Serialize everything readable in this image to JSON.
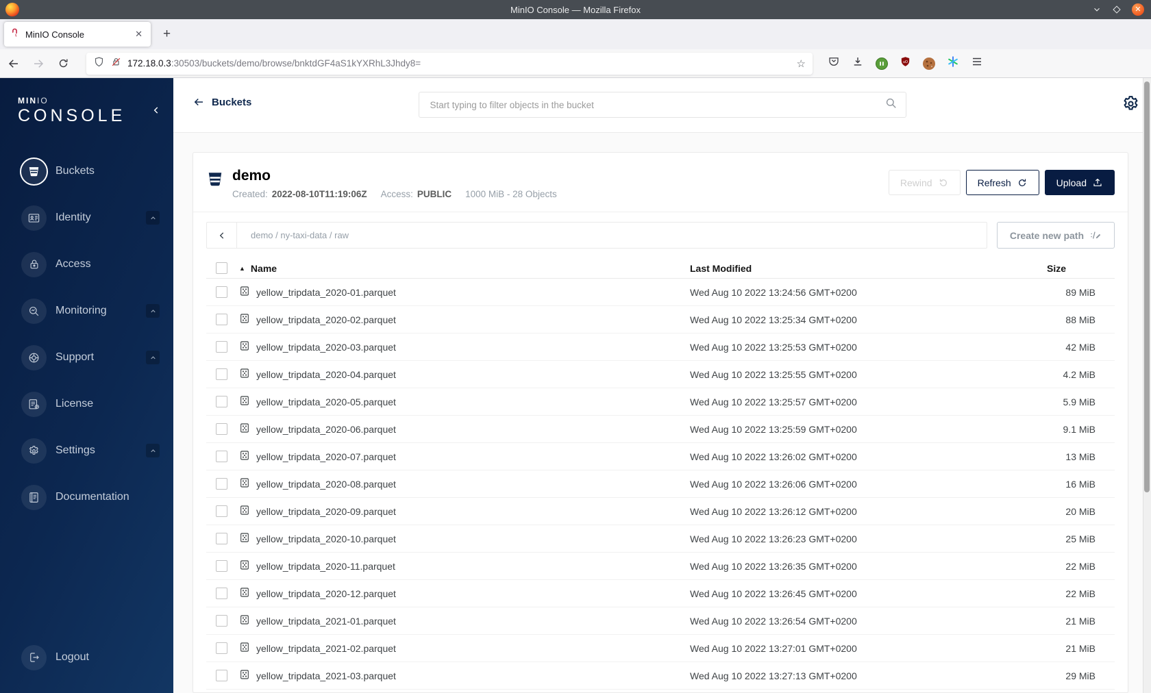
{
  "window": {
    "title": "MinIO Console — Mozilla Firefox"
  },
  "browser": {
    "tab_title": "MinIO Console",
    "tab_close": "✕",
    "new_tab": "+",
    "url_host": "172.18.0.3",
    "url_path": ":30503/buckets/demo/browse/bnktdGF4aS1kYXRhL3Jhdy8=",
    "bookmark_star": "☆"
  },
  "sidebar": {
    "brand_bold": "MIN",
    "brand_light": "IO",
    "product": "CONSOLE",
    "items": [
      {
        "id": "buckets",
        "label": "Buckets",
        "active": true,
        "expandable": false
      },
      {
        "id": "identity",
        "label": "Identity",
        "active": false,
        "expandable": true
      },
      {
        "id": "access",
        "label": "Access",
        "active": false,
        "expandable": false
      },
      {
        "id": "monitoring",
        "label": "Monitoring",
        "active": false,
        "expandable": true
      },
      {
        "id": "support",
        "label": "Support",
        "active": false,
        "expandable": true
      },
      {
        "id": "license",
        "label": "License",
        "active": false,
        "expandable": false
      },
      {
        "id": "settings",
        "label": "Settings",
        "active": false,
        "expandable": true
      },
      {
        "id": "documentation",
        "label": "Documentation",
        "active": false,
        "expandable": false
      }
    ],
    "logout_label": "Logout"
  },
  "topbar": {
    "back_label": "Buckets",
    "search_placeholder": "Start typing to filter objects in the bucket"
  },
  "bucket": {
    "name": "demo",
    "created_label": "Created:",
    "created": "2022-08-10T11:19:06Z",
    "access_label": "Access:",
    "access": "PUBLIC",
    "usage": "1000 MiB - 28 Objects",
    "actions": {
      "rewind": "Rewind",
      "refresh": "Refresh",
      "upload": "Upload"
    }
  },
  "pathbar": {
    "breadcrumb": "demo / ny-taxi-data / raw",
    "create_path": "Create new path"
  },
  "table": {
    "header": {
      "name": "Name",
      "modified": "Last Modified",
      "size": "Size",
      "sort_icon": "▲"
    },
    "rows": [
      {
        "name": "yellow_tripdata_2020-01.parquet",
        "modified": "Wed Aug 10 2022 13:24:56 GMT+0200",
        "size": "89 MiB"
      },
      {
        "name": "yellow_tripdata_2020-02.parquet",
        "modified": "Wed Aug 10 2022 13:25:34 GMT+0200",
        "size": "88 MiB"
      },
      {
        "name": "yellow_tripdata_2020-03.parquet",
        "modified": "Wed Aug 10 2022 13:25:53 GMT+0200",
        "size": "42 MiB"
      },
      {
        "name": "yellow_tripdata_2020-04.parquet",
        "modified": "Wed Aug 10 2022 13:25:55 GMT+0200",
        "size": "4.2 MiB"
      },
      {
        "name": "yellow_tripdata_2020-05.parquet",
        "modified": "Wed Aug 10 2022 13:25:57 GMT+0200",
        "size": "5.9 MiB"
      },
      {
        "name": "yellow_tripdata_2020-06.parquet",
        "modified": "Wed Aug 10 2022 13:25:59 GMT+0200",
        "size": "9.1 MiB"
      },
      {
        "name": "yellow_tripdata_2020-07.parquet",
        "modified": "Wed Aug 10 2022 13:26:02 GMT+0200",
        "size": "13 MiB"
      },
      {
        "name": "yellow_tripdata_2020-08.parquet",
        "modified": "Wed Aug 10 2022 13:26:06 GMT+0200",
        "size": "16 MiB"
      },
      {
        "name": "yellow_tripdata_2020-09.parquet",
        "modified": "Wed Aug 10 2022 13:26:12 GMT+0200",
        "size": "20 MiB"
      },
      {
        "name": "yellow_tripdata_2020-10.parquet",
        "modified": "Wed Aug 10 2022 13:26:23 GMT+0200",
        "size": "25 MiB"
      },
      {
        "name": "yellow_tripdata_2020-11.parquet",
        "modified": "Wed Aug 10 2022 13:26:35 GMT+0200",
        "size": "22 MiB"
      },
      {
        "name": "yellow_tripdata_2020-12.parquet",
        "modified": "Wed Aug 10 2022 13:26:45 GMT+0200",
        "size": "22 MiB"
      },
      {
        "name": "yellow_tripdata_2021-01.parquet",
        "modified": "Wed Aug 10 2022 13:26:54 GMT+0200",
        "size": "21 MiB"
      },
      {
        "name": "yellow_tripdata_2021-02.parquet",
        "modified": "Wed Aug 10 2022 13:27:01 GMT+0200",
        "size": "21 MiB"
      },
      {
        "name": "yellow_tripdata_2021-03.parquet",
        "modified": "Wed Aug 10 2022 13:27:13 GMT+0200",
        "size": "29 MiB"
      }
    ]
  },
  "colors": {
    "navy": "#081c42",
    "brand_red": "#c72c48",
    "muted": "#969fa8",
    "row_border": "#f1f1f1"
  }
}
